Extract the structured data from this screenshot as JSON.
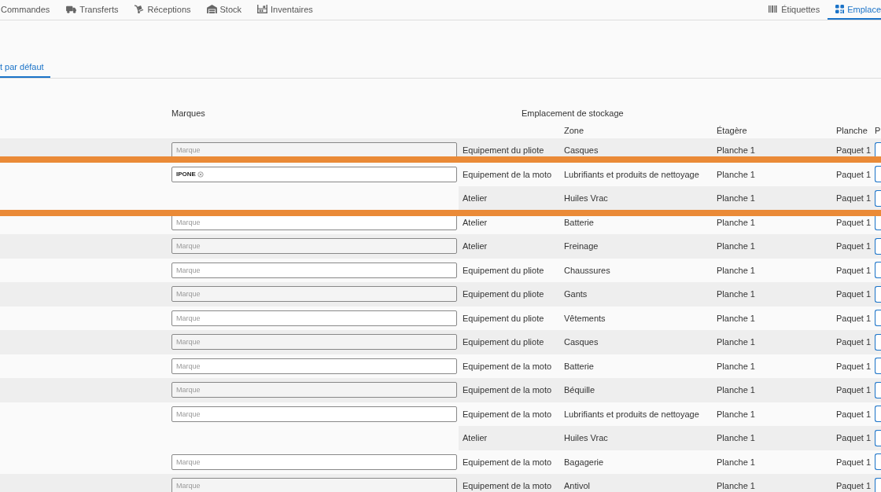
{
  "tabs": [
    {
      "label": "Commandes",
      "selected": false
    },
    {
      "label": "Transferts",
      "selected": false
    },
    {
      "label": "Réceptions",
      "selected": false
    },
    {
      "label": "Stock",
      "selected": false
    },
    {
      "label": "Inventaires",
      "selected": false
    },
    {
      "label": "Étiquettes",
      "selected": false
    },
    {
      "label": "Emplace",
      "selected": true
    }
  ],
  "subtabs": [
    {
      "label": "t par défaut",
      "selected": true
    }
  ],
  "table": {
    "brand_heading": "Marques",
    "group_heading": "Emplacement de stockage",
    "columns": [
      "Zone",
      "Étagère",
      "Planche",
      "P"
    ],
    "rows": [
      {
        "brand": {
          "kind": "field",
          "placeholder": "Marque"
        },
        "category": "Equipement du pliote",
        "zone": "Casques",
        "shelf": "Planche 1",
        "board": "Paquet 1",
        "highlight_below": true
      },
      {
        "brand": {
          "kind": "tag",
          "value": "IPONE"
        },
        "category": "Equipement de la moto",
        "zone": "Lubrifiants et produits de nettoyage",
        "shelf": "Planche 1",
        "board": "Paquet 1"
      },
      {
        "brand": {
          "kind": "none"
        },
        "category": "Atelier",
        "zone": "Huiles Vrac",
        "shelf": "Planche 1",
        "board": "Paquet 1"
      },
      {
        "brand": {
          "kind": "field",
          "placeholder": "Marque"
        },
        "category": "Atelier",
        "zone": "Batterie",
        "shelf": "Planche 1",
        "board": "Paquet 1",
        "highlight_above": true
      },
      {
        "brand": {
          "kind": "field",
          "placeholder": "Marque"
        },
        "category": "Atelier",
        "zone": "Freinage",
        "shelf": "Planche 1",
        "board": "Paquet 1"
      },
      {
        "brand": {
          "kind": "field",
          "placeholder": "Marque"
        },
        "category": "Equipement du pliote",
        "zone": "Chaussures",
        "shelf": "Planche 1",
        "board": "Paquet 1"
      },
      {
        "brand": {
          "kind": "field",
          "placeholder": "Marque"
        },
        "category": "Equipement du pliote",
        "zone": "Gants",
        "shelf": "Planche 1",
        "board": "Paquet 1"
      },
      {
        "brand": {
          "kind": "field",
          "placeholder": "Marque"
        },
        "category": "Equipement du pliote",
        "zone": "Vêtements",
        "shelf": "Planche 1",
        "board": "Paquet 1"
      },
      {
        "brand": {
          "kind": "field",
          "placeholder": "Marque"
        },
        "category": "Equipement du pliote",
        "zone": "Casques",
        "shelf": "Planche 1",
        "board": "Paquet 1"
      },
      {
        "brand": {
          "kind": "field",
          "placeholder": "Marque"
        },
        "category": "Equipement de la moto",
        "zone": "Batterie",
        "shelf": "Planche 1",
        "board": "Paquet 1"
      },
      {
        "brand": {
          "kind": "field",
          "placeholder": "Marque"
        },
        "category": "Equipement de la moto",
        "zone": "Béquille",
        "shelf": "Planche 1",
        "board": "Paquet 1"
      },
      {
        "brand": {
          "kind": "field",
          "placeholder": "Marque"
        },
        "category": "Equipement de la moto",
        "zone": "Lubrifiants et produits de nettoyage",
        "shelf": "Planche 1",
        "board": "Paquet 1"
      },
      {
        "brand": {
          "kind": "none"
        },
        "category": "Atelier",
        "zone": "Huiles Vrac",
        "shelf": "Planche 1",
        "board": "Paquet 1"
      },
      {
        "brand": {
          "kind": "field",
          "placeholder": "Marque"
        },
        "category": "Equipement de la moto",
        "zone": "Bagagerie",
        "shelf": "Planche 1",
        "board": "Paquet 1"
      },
      {
        "brand": {
          "kind": "field",
          "placeholder": "Marque"
        },
        "category": "Equipement de la moto",
        "zone": "Antivol",
        "shelf": "Planche 1",
        "board": "Paquet 1"
      }
    ]
  }
}
